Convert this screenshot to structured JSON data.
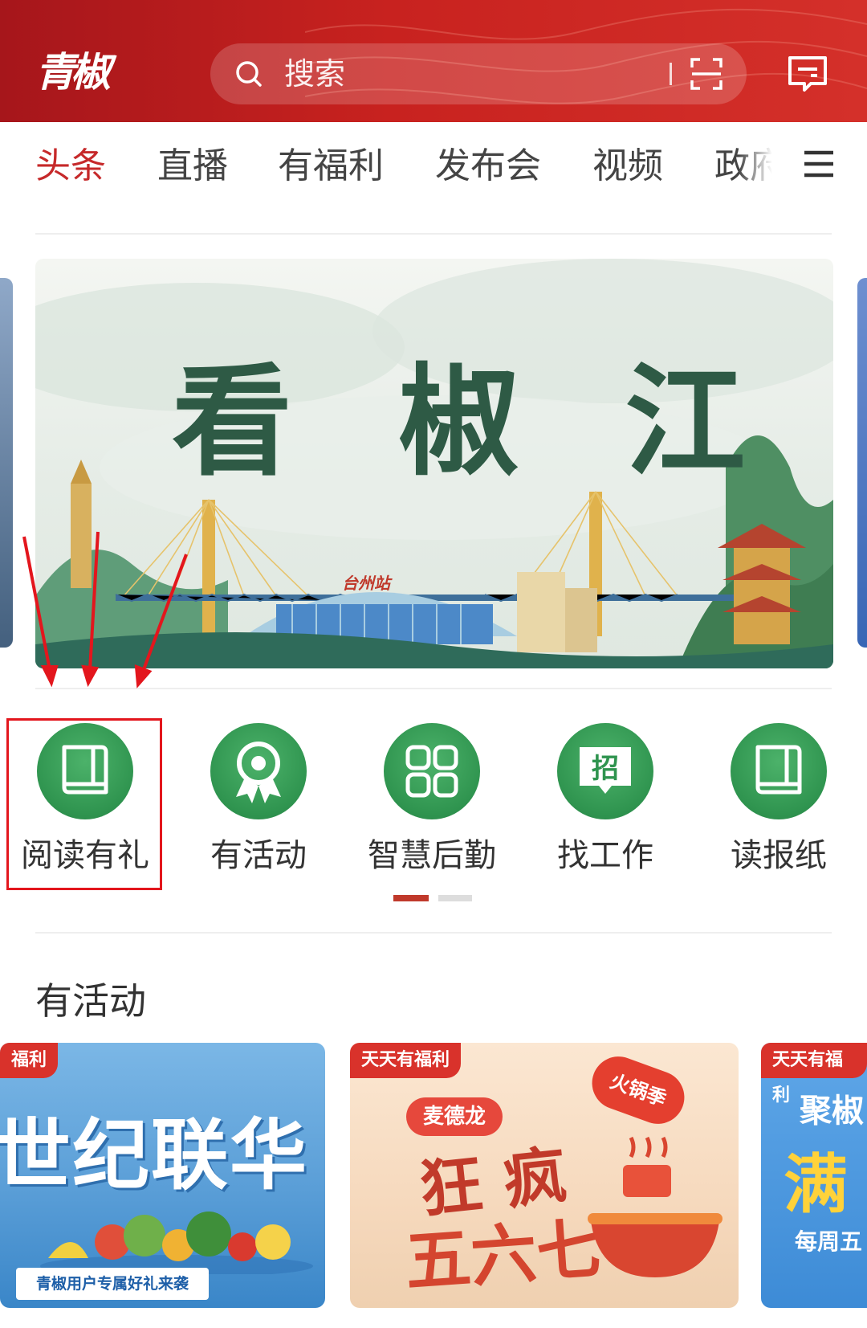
{
  "header": {
    "logo_text": "青椒",
    "search_placeholder": "搜索",
    "colors": {
      "header_bg": "#c8221f",
      "accent": "#c6292a"
    },
    "icons": [
      "search-icon",
      "scan-icon",
      "message-icon"
    ]
  },
  "nav": {
    "tabs": [
      {
        "label": "头条",
        "active": true
      },
      {
        "label": "直播",
        "active": false
      },
      {
        "label": "有福利",
        "active": false
      },
      {
        "label": "发布会",
        "active": false
      },
      {
        "label": "视频",
        "active": false
      },
      {
        "label": "政府",
        "active": false
      }
    ],
    "menu_icon": "hamburger-menu-icon"
  },
  "banner": {
    "title": "看 椒 江",
    "sign_text": "台州站"
  },
  "services": {
    "items": [
      {
        "label": "阅读有礼",
        "icon": "book-icon",
        "highlighted": true
      },
      {
        "label": "有活动",
        "icon": "award-icon",
        "highlighted": false
      },
      {
        "label": "智慧后勤",
        "icon": "grid-icon",
        "highlighted": false
      },
      {
        "label": "找工作",
        "icon": "job-icon",
        "icon_char": "招",
        "highlighted": false
      },
      {
        "label": "读报纸",
        "icon": "book-icon",
        "highlighted": false
      }
    ],
    "page_indicator": {
      "pages": 2,
      "current": 1
    }
  },
  "activities": {
    "title": "有活动",
    "cards": [
      {
        "badge": "福利",
        "headline": "世纪联华",
        "strip": "青椒用户专属好礼来袭"
      },
      {
        "badge": "天天有福利",
        "brand": "麦德龙",
        "bubble": "火锅季",
        "line1": "狂 疯",
        "line2": "五六七"
      },
      {
        "badge": "天天有福利",
        "line1": "聚椒",
        "line2": "满",
        "line3": "每周五"
      }
    ]
  }
}
